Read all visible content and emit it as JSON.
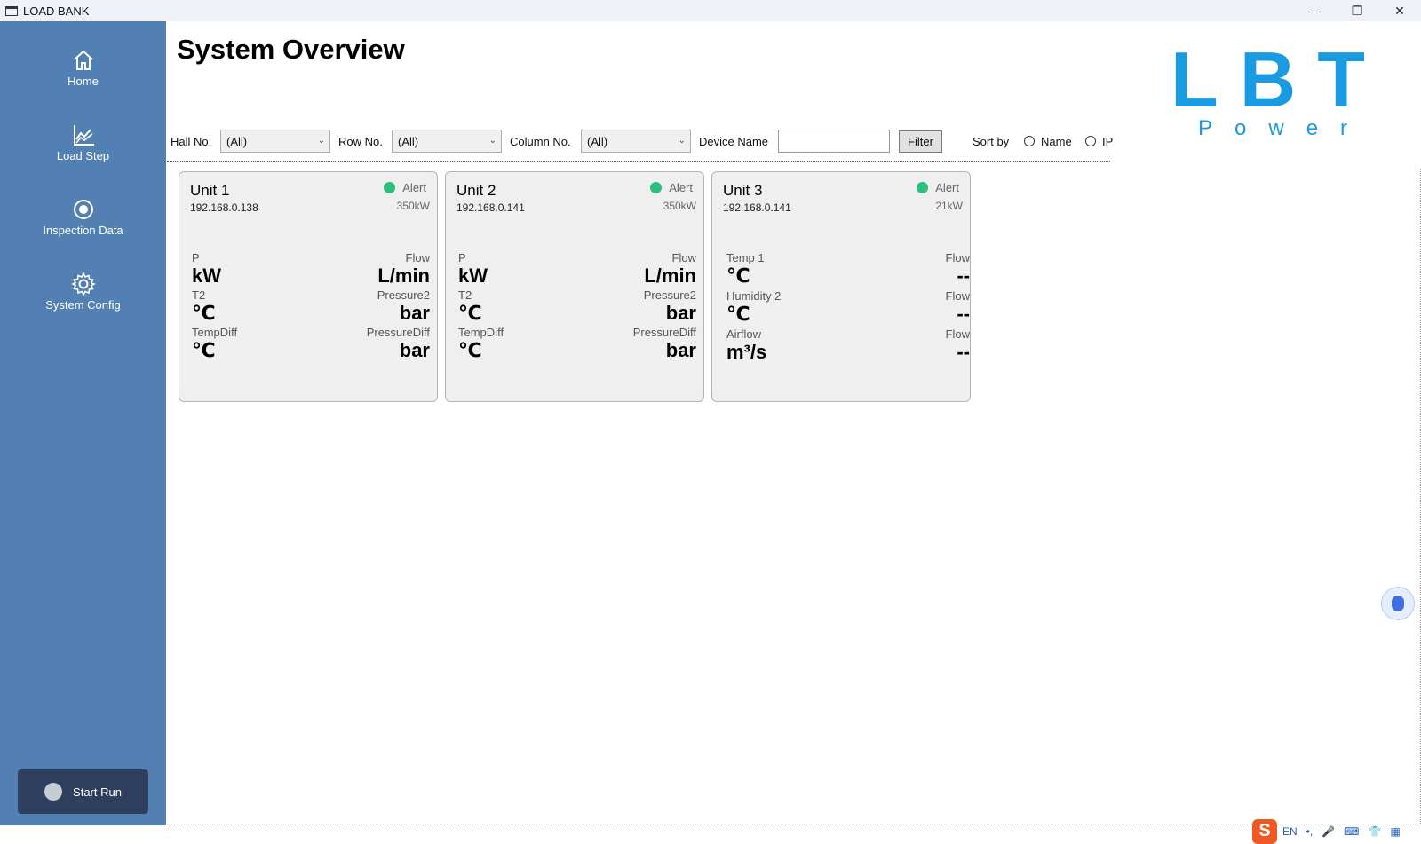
{
  "window": {
    "title": "LOAD BANK",
    "minimize": "—",
    "restore": "❐",
    "close": "✕"
  },
  "sidebar": {
    "items": [
      {
        "label": "Home",
        "icon": "home-icon"
      },
      {
        "label": "Load Step",
        "icon": "chart-icon"
      },
      {
        "label": "Inspection Data",
        "icon": "record-icon"
      },
      {
        "label": "System Config",
        "icon": "gear-icon"
      }
    ],
    "start_button": "Start Run"
  },
  "page": {
    "title": "System Overview"
  },
  "logo": {
    "line1": "LBT",
    "line2": "Power",
    "color": "#1a9ae0"
  },
  "filters": {
    "hall_label": "Hall No.",
    "hall_value": "(All)",
    "row_label": "Row No.",
    "row_value": "(All)",
    "column_label": "Column No.",
    "column_value": "(All)",
    "device_label": "Device Name",
    "device_value": "",
    "filter_button": "Filter",
    "sort_label": "Sort by",
    "sort_name": "Name",
    "sort_ip": "IP"
  },
  "cards": [
    {
      "name": "Unit 1",
      "ip": "192.168.0.138",
      "status": "Alert",
      "power": "350kW",
      "metrics": [
        {
          "label": "P",
          "value": "kW"
        },
        {
          "label": "Flow",
          "value": "L/min"
        },
        {
          "label": "T2",
          "value": "℃"
        },
        {
          "label": "Pressure2",
          "value": "bar"
        },
        {
          "label": "TempDiff",
          "value": "℃"
        },
        {
          "label": "PressureDiff",
          "value": "bar"
        }
      ]
    },
    {
      "name": "Unit 2",
      "ip": "192.168.0.141",
      "status": "Alert",
      "power": "350kW",
      "metrics": [
        {
          "label": "P",
          "value": "kW"
        },
        {
          "label": "Flow",
          "value": "L/min"
        },
        {
          "label": "T2",
          "value": "℃"
        },
        {
          "label": "Pressure2",
          "value": "bar"
        },
        {
          "label": "TempDiff",
          "value": "℃"
        },
        {
          "label": "PressureDiff",
          "value": "bar"
        }
      ]
    },
    {
      "name": "Unit 3",
      "ip": "192.168.0.141",
      "status": "Alert",
      "power": "21kW",
      "metrics": [
        {
          "label": "Temp 1",
          "value": "℃"
        },
        {
          "label": "Flow",
          "value": "--"
        },
        {
          "label": "Humidity 2",
          "value": "℃"
        },
        {
          "label": "Flow",
          "value": "--"
        },
        {
          "label": "Airflow",
          "value": "m³/s"
        },
        {
          "label": "Flow",
          "value": "--"
        }
      ]
    }
  ],
  "colors": {
    "sidebar": "#5280b3",
    "start_button": "#2d3f5c",
    "status_ok": "#2dbf7c",
    "card_bg": "#efefef"
  },
  "taskbar": {
    "ime_logo": "S",
    "lang": "EN"
  }
}
